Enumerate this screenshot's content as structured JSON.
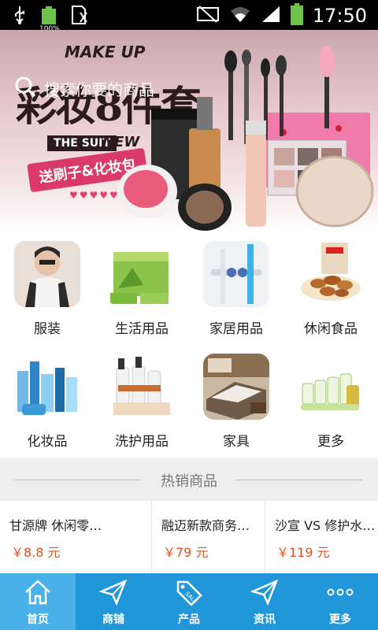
{
  "status_bar": {
    "time": "17:50",
    "battery_left_percent": "100%",
    "colors": {
      "background": "#000000",
      "battery": "#6cc24a"
    }
  },
  "banner": {
    "title": "彩妆8件套",
    "make_up": "MAKE UP",
    "suit": "THE SUIT",
    "new": "NEW",
    "promo": "送刷子&化妆包",
    "search_placeholder": "搜索你要的商品",
    "slides_total": 4,
    "active_slide": 1
  },
  "categories": [
    {
      "label": "服装",
      "icon": "clothing-image"
    },
    {
      "label": "生活用品",
      "icon": "daily-goods-image"
    },
    {
      "label": "家居用品",
      "icon": "home-goods-image"
    },
    {
      "label": "休闲食品",
      "icon": "snacks-image"
    },
    {
      "label": "化妆品",
      "icon": "cosmetics-image"
    },
    {
      "label": "洗护用品",
      "icon": "care-products-image"
    },
    {
      "label": "家具",
      "icon": "furniture-image"
    },
    {
      "label": "更多",
      "icon": "more-image"
    }
  ],
  "hot": {
    "title": "热销商品",
    "products": [
      {
        "name": "甘源牌 休闲零食 兰花豆",
        "price": "￥8.8 元"
      },
      {
        "name": "融迈新款商务休闲鞋",
        "price": "￥79 元"
      },
      {
        "name": "沙宣 VS 修护水养洗发露",
        "price": "￥119 元"
      }
    ]
  },
  "tabbar": {
    "items": [
      {
        "label": "首页",
        "icon": "home-icon"
      },
      {
        "label": "商铺",
        "icon": "send-icon"
      },
      {
        "label": "产品",
        "icon": "sale-tag-icon"
      },
      {
        "label": "资讯",
        "icon": "send-icon"
      },
      {
        "label": "更多",
        "icon": "more-dots-icon"
      }
    ],
    "active_index": 0,
    "colors": {
      "background": "#2196d8",
      "active": "#4ab0e8"
    }
  },
  "price_color": "#e8501b"
}
